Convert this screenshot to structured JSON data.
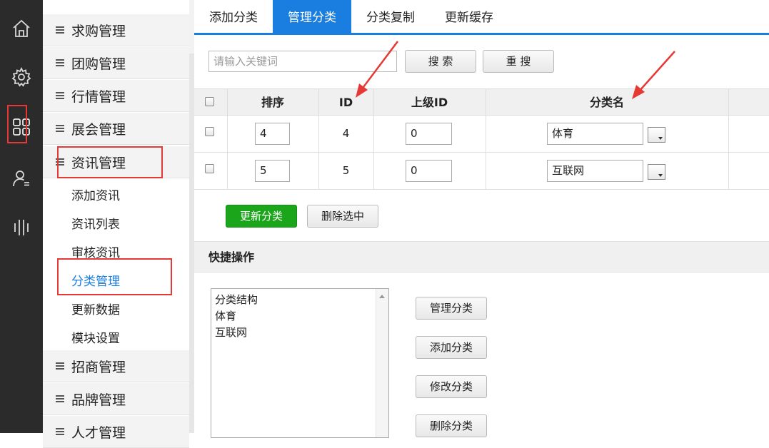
{
  "sidebar_icons": [
    {
      "name": "home-icon"
    },
    {
      "name": "gear-icon"
    },
    {
      "name": "grid-icon"
    },
    {
      "name": "user-icon"
    },
    {
      "name": "bars-icon"
    }
  ],
  "menu": {
    "sections_top": [
      {
        "label": "求购管理"
      },
      {
        "label": "团购管理"
      },
      {
        "label": "行情管理"
      },
      {
        "label": "展会管理"
      },
      {
        "label": "资讯管理"
      }
    ],
    "sub_items": [
      {
        "label": "添加资讯"
      },
      {
        "label": "资讯列表"
      },
      {
        "label": "审核资讯"
      },
      {
        "label": "分类管理"
      },
      {
        "label": "更新数据"
      },
      {
        "label": "模块设置"
      }
    ],
    "sections_bottom": [
      {
        "label": "招商管理"
      },
      {
        "label": "品牌管理"
      },
      {
        "label": "人才管理"
      }
    ]
  },
  "tabs": [
    {
      "label": "添加分类"
    },
    {
      "label": "管理分类"
    },
    {
      "label": "分类复制"
    },
    {
      "label": "更新缓存"
    }
  ],
  "search": {
    "placeholder": "请输入关键词",
    "search_label": "搜 索",
    "reset_label": "重 搜"
  },
  "table": {
    "headers": {
      "order": "排序",
      "id": "ID",
      "parent_id": "上级ID",
      "name": "分类名"
    },
    "rows": [
      {
        "order": "4",
        "id": "4",
        "parent_id": "0",
        "name": "体育"
      },
      {
        "order": "5",
        "id": "5",
        "parent_id": "0",
        "name": "互联网"
      }
    ]
  },
  "actions": {
    "update_label": "更新分类",
    "delete_label": "删除选中"
  },
  "quick": {
    "title": "快捷操作",
    "list_options": [
      "分类结构",
      "体育",
      "互联网"
    ],
    "buttons": [
      "管理分类",
      "添加分类",
      "修改分类",
      "删除分类"
    ]
  },
  "colors": {
    "accent": "#1a7ee0",
    "primary_button": "#1aa51a",
    "annotation": "#e53935"
  }
}
